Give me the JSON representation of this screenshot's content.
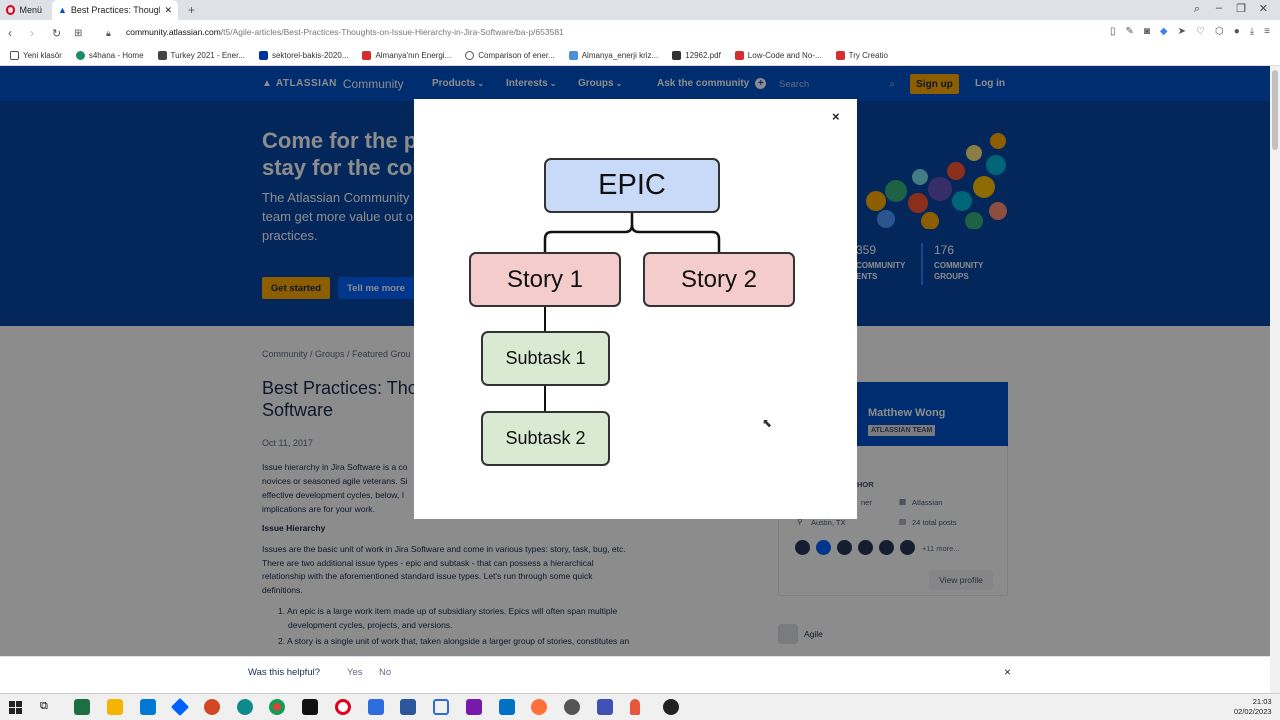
{
  "browser": {
    "menu_label": "Menü",
    "active_tab_title": "Best Practices: Thoughts o",
    "url_domain": "community.atlassian.com",
    "url_path": "/t5/Agile-articles/Best-Practices-Thoughts-on-Issue-Hierarchy-in-Jira-Software/ba-p/653581",
    "bookmarks": [
      "Yeni klasör",
      "s4hana - Home",
      "Turkey 2021 - Ener...",
      "sektorel-bakis-2020...",
      "Almanya'nın Energi...",
      "Comparison of ener...",
      "Almanya_enerji kriz...",
      "12962.pdf",
      "Low-Code and No-...",
      "Try Creatio"
    ]
  },
  "nav": {
    "logo": "ATLASSIAN",
    "logo_suffix": "Community",
    "products": "Products",
    "interests": "Interests",
    "groups": "Groups",
    "ask": "Ask the community",
    "search_placeholder": "Search",
    "signup": "Sign up",
    "login": "Log in"
  },
  "hero": {
    "title_line1": "Come for the pr",
    "title_line2": "stay for the con",
    "desc_line1": "The Atlassian Community",
    "desc_line2": "team get more value out o",
    "desc_line3": "practices.",
    "get_started": "Get started",
    "tell_more": "Tell me more",
    "stat1_num": "359",
    "stat1_label1": "COMMUNITY",
    "stat1_label2": "ENTS",
    "stat2_num": "176",
    "stat2_label1": "COMMUNITY",
    "stat2_label2": "GROUPS"
  },
  "article": {
    "breadcrumb": "Community / Groups / Featured Grou",
    "title_line1": "Best Practices: Tho",
    "title_line2": "Software",
    "date": "Oct 11, 2017",
    "intro1": "Issue hierarchy in Jira Software is a co",
    "intro2": "novices or seasoned agile veterans. Si",
    "intro3": "effective development cycles, below, I",
    "intro4": "implications are for your work.",
    "section_heading": "Issue Hierarchy",
    "para1": "Issues are the basic unit of work in Jira Software and come in various types: story, task, bug, etc.",
    "para2": "There are two additional issue types - epic and subtask - that can possess a hierarchical",
    "para3": "relationship with the aforementioned standard issue types. Let's run through some quick",
    "para4": "definitions.",
    "li1a": "1. An epic is a large work item made up of subsidiary stories. Epics will often span multiple",
    "li1b": "development cycles, projects, and versions.",
    "li2a": "2. A story is a single unit of work that, taken alongside a larger group of stories, constitutes an"
  },
  "author": {
    "name": "Matthew Wong",
    "badge": "ATLASSIAN TEAM",
    "section": "HOR",
    "role": "ner",
    "company": "Atlassian",
    "location": "Austin, TX",
    "posts": "24 total posts",
    "more": "+11 more...",
    "view_profile": "View profile",
    "group": "Agile"
  },
  "feedback": {
    "question": "Was this helpful?",
    "yes": "Yes",
    "no": "No",
    "close": "×"
  },
  "modal": {
    "close": "×",
    "epic": "EPIC",
    "story1": "Story 1",
    "story2": "Story 2",
    "subtask1": "Subtask 1",
    "subtask2": "Subtask 2",
    "colors": {
      "epic_fill": "#c9daf8",
      "story_fill": "#f4cccc",
      "subtask_fill": "#d9ead3"
    }
  },
  "taskbar": {
    "time": "21:03",
    "date": "02/02/2023"
  }
}
